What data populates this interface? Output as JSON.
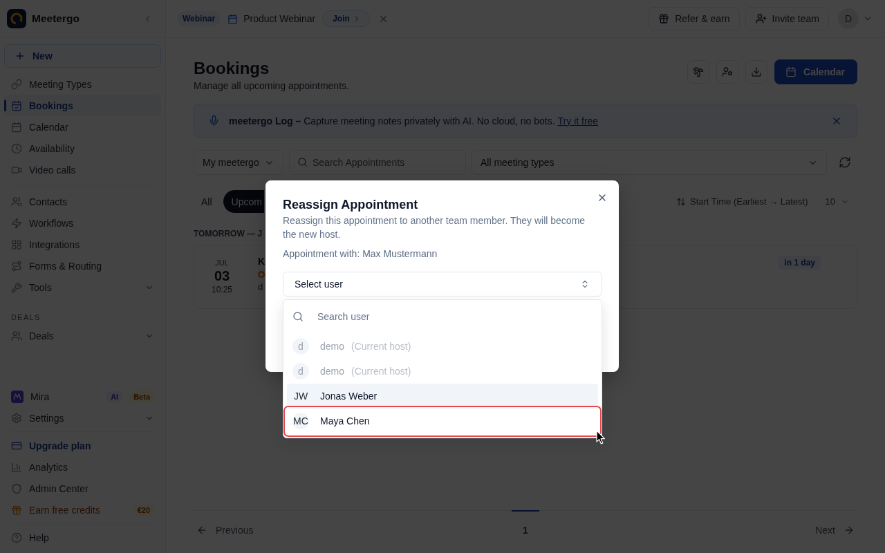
{
  "sidebar": {
    "brand": {
      "name": "Meetergo"
    },
    "new_button": {
      "label": "New"
    },
    "groups": [
      {
        "items": [
          {
            "label": "Meeting Types",
            "selected": false
          },
          {
            "label": "Bookings",
            "selected": true
          },
          {
            "label": "Calendar",
            "selected": false
          },
          {
            "label": "Availability",
            "selected": false
          },
          {
            "label": "Video calls",
            "selected": false
          }
        ]
      },
      {
        "items": [
          {
            "label": "Contacts",
            "selected": false
          },
          {
            "label": "Workflows",
            "selected": false
          },
          {
            "label": "Integrations",
            "selected": false
          },
          {
            "label": "Forms & Routing",
            "selected": false
          },
          {
            "label": "Tools",
            "selected": false,
            "expanded": false
          }
        ]
      },
      {
        "heading": "DEALS",
        "items": [
          {
            "label": "Deals",
            "selected": false,
            "expanded": false
          }
        ]
      }
    ],
    "bottom_groups": [
      {
        "items": [
          {
            "label": "Mira",
            "selected": false,
            "badges": [
              {
                "text": "AI",
                "kind": "ai"
              },
              {
                "text": "Beta",
                "kind": "beta"
              }
            ]
          },
          {
            "label": "Settings",
            "selected": false,
            "expanded": false
          }
        ]
      },
      {
        "items": [
          {
            "label": "Upgrade plan",
            "kind": "upgrade",
            "selected": false
          },
          {
            "label": "Analytics",
            "kind": "plain",
            "selected": false
          },
          {
            "label": "Admin Center",
            "kind": "plain",
            "selected": false
          },
          {
            "label": "Earn free credits",
            "kind": "reward",
            "selected": false,
            "badges": [
              {
                "text": "€20",
                "kind": "reward"
              }
            ]
          }
        ]
      },
      {
        "items": [
          {
            "label": "Help",
            "selected": false
          }
        ]
      }
    ]
  },
  "top_bar": {
    "webinar": {
      "badge": "Webinar",
      "title": "Product Webinar",
      "join_button": "Join"
    },
    "buttons": [
      {
        "label": "Refer & earn"
      },
      {
        "label": "Invite team"
      }
    ],
    "avatar": {
      "initial": "D"
    }
  },
  "page": {
    "title": "Bookings",
    "subtitle": "Manage all upcoming appointments.",
    "calendar_button": "Calendar",
    "banner": {
      "text": "**meetergo Log –** Capture meeting notes privately with AI. No cloud, no bots.",
      "link": "Try it free"
    },
    "filters": {
      "workspace_select": "My meetergo",
      "search": {
        "placeholder": "Search Appointments"
      },
      "type_select": "All meeting types"
    },
    "tabs": [
      {
        "label": "All",
        "selected": false
      },
      {
        "label": "Upcom",
        "selected": true
      }
    ],
    "sort": {
      "label": "Start Time (Earliest → Latest)",
      "page_size": "10"
    },
    "groups": [
      {
        "heading": "TOMORROW — J",
        "bookings": [
          {
            "month": "JUL",
            "day": "03",
            "time": "10:25",
            "title": "K",
            "host": "d",
            "badge": "in 1 day"
          }
        ]
      }
    ],
    "pagination": {
      "previous": "Previous",
      "pages": [
        {
          "label": "1",
          "selected": true
        }
      ],
      "next": "Next"
    }
  },
  "reassign_dialog": {
    "title": "Reassign Appointment",
    "description": "Reassign this appointment to another team member. They will become the new host.",
    "appointment": "Appointment with: Max Mustermann",
    "select": {
      "label": "Select user",
      "expanded": true
    },
    "search": {
      "placeholder": "Search user"
    },
    "options": [
      {
        "initials": "d",
        "name": "demo",
        "note": "(Current host)",
        "disabled": true,
        "selected": false,
        "highlighted": false
      },
      {
        "initials": "d",
        "name": "demo",
        "note": "(Current host)",
        "disabled": true,
        "selected": false,
        "highlighted": false
      },
      {
        "initials": "JW",
        "name": "Jonas Weber",
        "disabled": false,
        "selected": true,
        "highlighted": false
      },
      {
        "initials": "MC",
        "name": "Maya Chen",
        "disabled": false,
        "selected": false,
        "highlighted": true
      }
    ]
  }
}
